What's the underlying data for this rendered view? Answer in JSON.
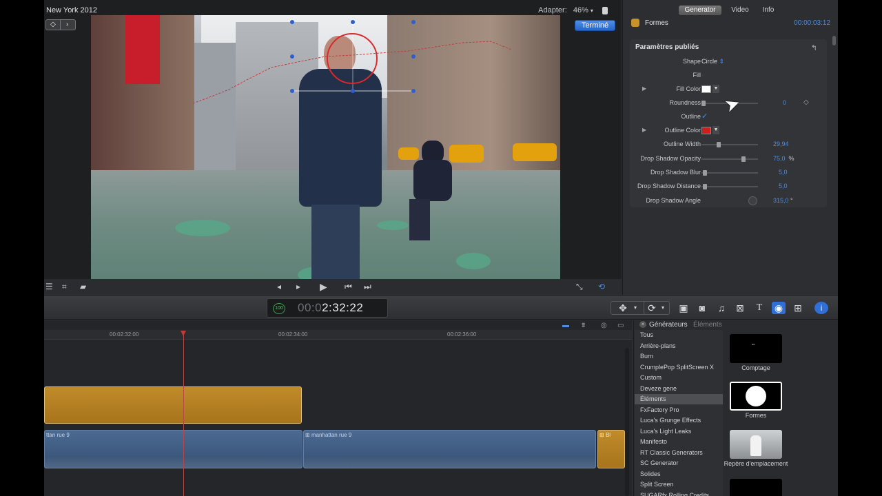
{
  "viewer": {
    "project_title": "New York 2012",
    "adapter_label": "Adapter:",
    "zoom": "46%",
    "done_button": "Terminé"
  },
  "inspector": {
    "tabs": [
      "Generator",
      "Video",
      "Info"
    ],
    "item_name": "Formes",
    "timecode": "00:00:03:12",
    "section_title": "Paramètres publiés",
    "params": {
      "shape": {
        "label": "Shape",
        "value": "Circle"
      },
      "fill": {
        "label": "Fill"
      },
      "fill_color": {
        "label": "Fill Color",
        "color": "#ffffff"
      },
      "roundness": {
        "label": "Roundness",
        "value": "0",
        "level": 0
      },
      "outline": {
        "label": "Outline",
        "checked": true
      },
      "outline_color": {
        "label": "Outline Color",
        "color": "#d01e1e"
      },
      "outline_width": {
        "label": "Outline Width",
        "value": "29,94",
        "level": 0.3
      },
      "drop_shadow_opacity": {
        "label": "Drop Shadow Opacity",
        "value": "75,0",
        "unit": "%",
        "level": 0.75
      },
      "drop_shadow_blur": {
        "label": "Drop Shadow Blur",
        "value": "5,0",
        "level": 0.05
      },
      "drop_shadow_distance": {
        "label": "Drop Shadow Distance",
        "value": "5,0",
        "level": 0.05
      },
      "drop_shadow_angle": {
        "label": "Drop Shadow Angle",
        "value": "315,0",
        "unit": "°"
      }
    }
  },
  "toolbar": {
    "timecode": "2:32:22",
    "timecode_prefix": "00:0",
    "badge": "100"
  },
  "timeline": {
    "ruler": [
      "00:02:32:00",
      "00:02:34:00",
      "00:02:36:00"
    ],
    "clips": {
      "video_a": "ttan rue 9",
      "video_b": "manhattan rue 9",
      "gen_small": "Bl"
    }
  },
  "browser": {
    "tab_active": "Générateurs",
    "tab_inactive": "Éléments",
    "categories": [
      "Tous",
      "Arrière-plans",
      "Burn",
      "CrumplePop SplitScreen X",
      "Custom",
      "Deveze gene",
      "Éléments",
      "FxFactory Pro",
      "Luca's Grunge Effects",
      "Luca's Light Leaks",
      "Manifesto",
      "RT Classic Generators",
      "SC Generator",
      "Solides",
      "Split Screen",
      "SUGARfx Rolling Credits"
    ],
    "selected_category": 6,
    "thumbs": [
      {
        "label": "Comptage"
      },
      {
        "label": "Formes"
      },
      {
        "label": "Repère d'emplacement"
      }
    ]
  }
}
